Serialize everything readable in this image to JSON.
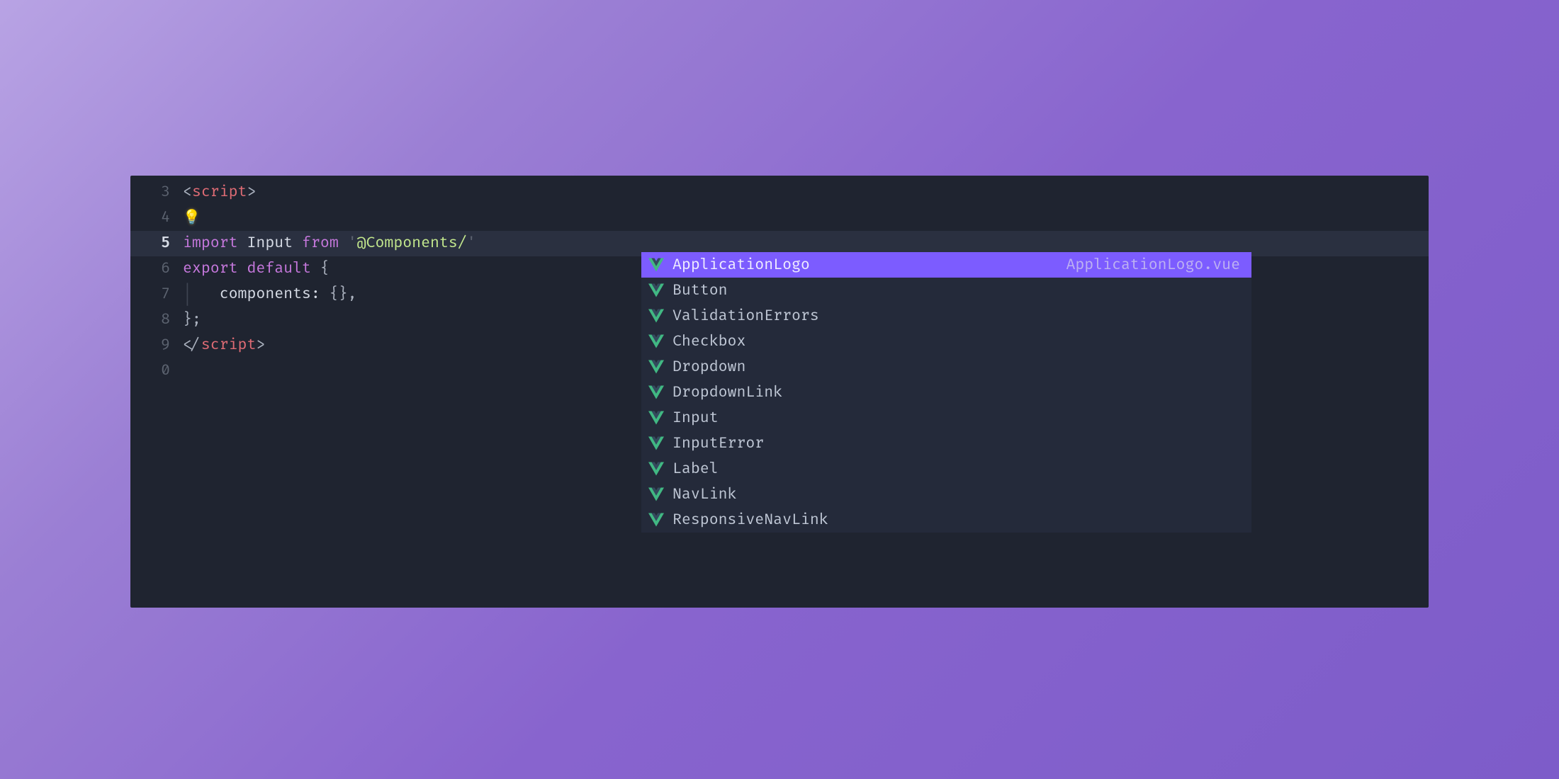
{
  "line_numbers": [
    "3",
    "4",
    "5",
    "6",
    "7",
    "8",
    "9",
    "0"
  ],
  "active_line_number": "5",
  "code": {
    "l3": {
      "open": "<",
      "tag": "script",
      "close": ">"
    },
    "l5": {
      "kw1": "import",
      "ident": "Input",
      "kw2": "from",
      "q": "'",
      "str": "@Components/",
      "q2": "'"
    },
    "l6": {
      "kw1": "export",
      "kw2": "default",
      "brace": "{"
    },
    "l7": {
      "key": "components:",
      "val": "{},",
      "guide": "│   "
    },
    "l8": {
      "close": "};"
    },
    "l9": {
      "open": "</",
      "tag": "script",
      "close": ">"
    }
  },
  "autocomplete": {
    "selected_index": 0,
    "items": [
      {
        "label": "ApplicationLogo",
        "detail": "ApplicationLogo.vue"
      },
      {
        "label": "Button"
      },
      {
        "label": "ValidationErrors"
      },
      {
        "label": "Checkbox"
      },
      {
        "label": "Dropdown"
      },
      {
        "label": "DropdownLink"
      },
      {
        "label": "Input"
      },
      {
        "label": "InputError"
      },
      {
        "label": "Label"
      },
      {
        "label": "NavLink"
      },
      {
        "label": "ResponsiveNavLink"
      }
    ]
  }
}
